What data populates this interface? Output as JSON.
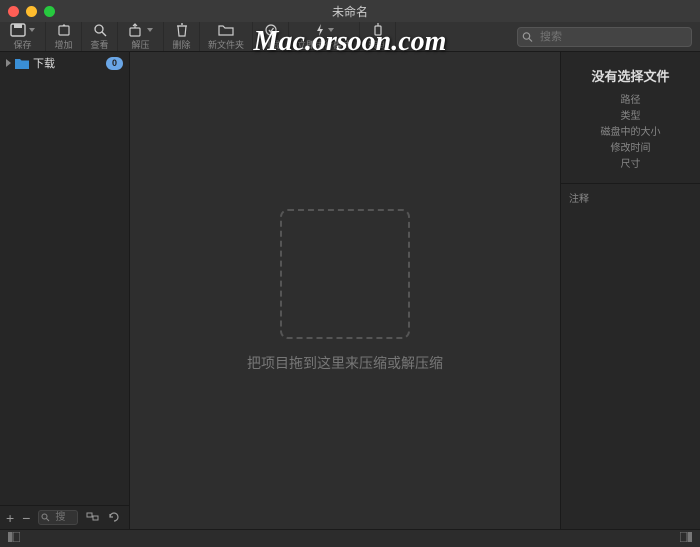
{
  "window": {
    "title": "未命名"
  },
  "watermark": "Mac.orsoon.com",
  "toolbar": {
    "save": "保存",
    "add": "增加",
    "view": "查看",
    "extract": "解压",
    "delete": "删除",
    "newfolder": "新文件夹",
    "test": "测试",
    "execmode": "立即执行模式",
    "goto": "转到",
    "search_placeholder": "搜索"
  },
  "sidebar": {
    "items": [
      {
        "label": "下载",
        "badge": "0"
      }
    ],
    "filter_placeholder": "搜"
  },
  "dropzone": {
    "hint": "把项目拖到这里来压缩或解压缩"
  },
  "rightpanel": {
    "heading": "没有选择文件",
    "rows": {
      "path": "路径",
      "type": "类型",
      "disksize": "磁盘中的大小",
      "modtime": "修改时间",
      "size": "尺寸"
    },
    "notes_label": "注释"
  }
}
